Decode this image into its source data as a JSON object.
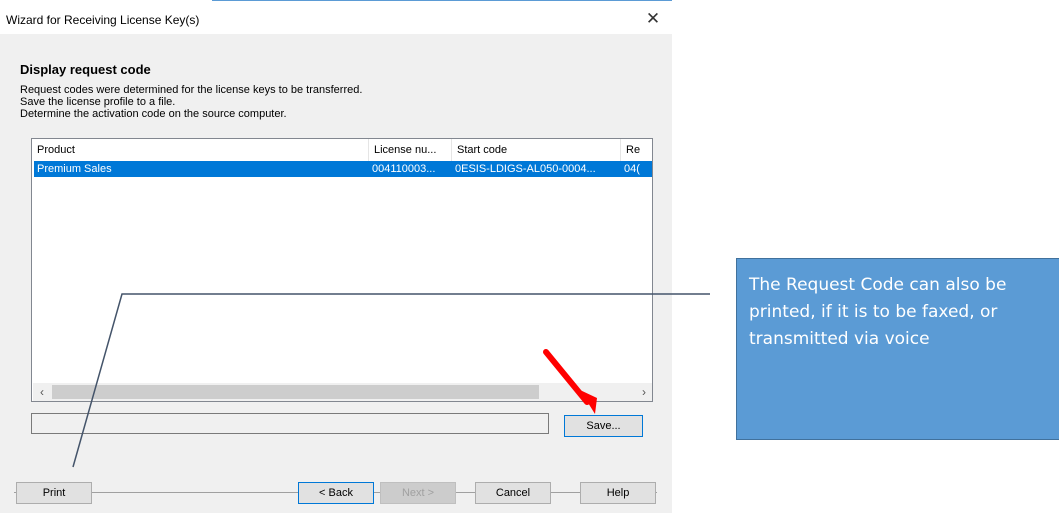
{
  "window": {
    "title": "Wizard for Receiving License Key(s)",
    "close_glyph": "✕"
  },
  "page": {
    "heading": "Display request code",
    "description_lines": [
      "Request codes were determined for the license keys to be transferred.",
      "Save the license profile to a file.",
      "Determine the activation code on the source computer."
    ]
  },
  "table": {
    "columns": [
      "Product",
      "License nu...",
      "Start code",
      "Re"
    ],
    "rows": [
      {
        "product": "Premium Sales",
        "license_number": "004110003...",
        "start_code": "0ESIS-LDIGS-AL050-0004...",
        "re": "04("
      }
    ],
    "selected_row": 0,
    "scroll_left_glyph": "‹",
    "scroll_right_glyph": "›"
  },
  "path_field": {
    "value": ""
  },
  "buttons": {
    "save": "Save...",
    "print": "Print",
    "back": "< Back",
    "next": "Next >",
    "cancel": "Cancel",
    "help": "Help"
  },
  "annotation": {
    "callout_text": "The Request Code can also be printed, if it is to be faxed, or transmitted via voice",
    "callout_color": "#5b9bd5",
    "arrow_color": "#ff0000",
    "connector_color": "#44546a"
  },
  "top_strip": {
    "text": ""
  }
}
